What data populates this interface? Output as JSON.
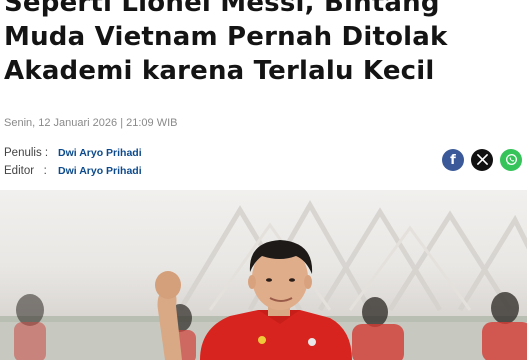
{
  "article": {
    "title_lines": [
      "Seperti Lionel Messi, Bintang",
      "Muda Vietnam Pernah Ditolak",
      "Akademi karena Terlalu Kecil"
    ],
    "dateline": "Senin, 12 Januari 2026 | 21:09 WIB",
    "writer_label": "Penulis :",
    "writer_name": "Dwi Aryo Prihadi",
    "editor_label": "Editor   :",
    "editor_name": "Dwi Aryo Prihadi"
  },
  "share": {
    "facebook_glyph": "f",
    "x_glyph": "𝕏",
    "whatsapp_glyph": "✆",
    "icons": [
      "facebook-icon",
      "x-icon",
      "whatsapp-icon"
    ],
    "colors": {
      "facebook": "#3b5998",
      "x": "#111111",
      "whatsapp": "#35c35a"
    }
  },
  "hero_image": {
    "description_icon": "football-player-photo",
    "jersey_color": "#d8241e"
  },
  "colors": {
    "title": "#141414",
    "author_link": "#0c4a8c",
    "dateline": "#8a8a8a"
  }
}
